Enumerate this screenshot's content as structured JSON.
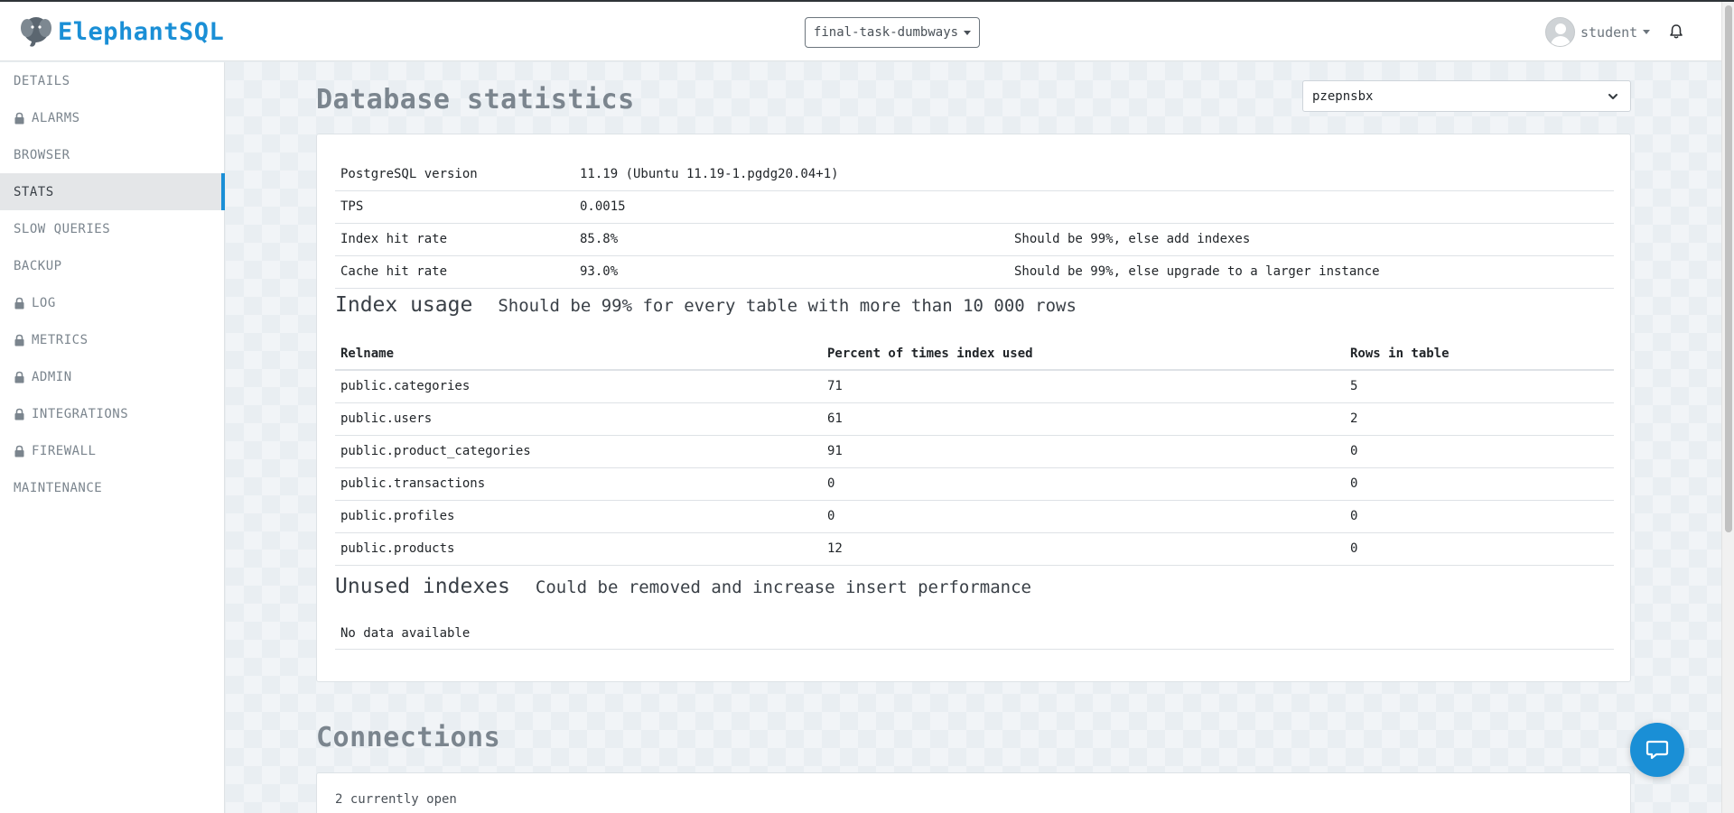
{
  "brand": {
    "name": "ElephantSQL",
    "accent": "#1a8fd6"
  },
  "header": {
    "instance": "final-task-dumbways",
    "user": "student"
  },
  "sidebar": {
    "items": [
      {
        "label": "DETAILS",
        "locked": false,
        "active": false
      },
      {
        "label": "ALARMS",
        "locked": true,
        "active": false
      },
      {
        "label": "BROWSER",
        "locked": false,
        "active": false
      },
      {
        "label": "STATS",
        "locked": false,
        "active": true
      },
      {
        "label": "SLOW QUERIES",
        "locked": false,
        "active": false
      },
      {
        "label": "BACKUP",
        "locked": false,
        "active": false
      },
      {
        "label": "LOG",
        "locked": true,
        "active": false
      },
      {
        "label": "METRICS",
        "locked": true,
        "active": false
      },
      {
        "label": "ADMIN",
        "locked": true,
        "active": false
      },
      {
        "label": "INTEGRATIONS",
        "locked": true,
        "active": false
      },
      {
        "label": "FIREWALL",
        "locked": true,
        "active": false
      },
      {
        "label": "MAINTENANCE",
        "locked": false,
        "active": false
      }
    ]
  },
  "main": {
    "title": "Database statistics",
    "database_select": "pzepnsbx",
    "stats": [
      {
        "label": "PostgreSQL version",
        "value": "11.19 (Ubuntu 11.19-1.pgdg20.04+1)",
        "note": ""
      },
      {
        "label": "TPS",
        "value": "0.0015",
        "note": ""
      },
      {
        "label": "Index hit rate",
        "value": "85.8%",
        "note": "Should be 99%, else add indexes"
      },
      {
        "label": "Cache hit rate",
        "value": "93.0%",
        "note": "Should be 99%, else upgrade to a larger instance"
      }
    ],
    "index_usage": {
      "heading": "Index usage",
      "subheading": "Should be 99% for every table with more than 10 000 rows",
      "columns": [
        "Relname",
        "Percent of times index used",
        "Rows in table"
      ],
      "rows": [
        [
          "public.categories",
          "71",
          "5"
        ],
        [
          "public.users",
          "61",
          "2"
        ],
        [
          "public.product_categories",
          "91",
          "0"
        ],
        [
          "public.transactions",
          "0",
          "0"
        ],
        [
          "public.profiles",
          "0",
          "0"
        ],
        [
          "public.products",
          "12",
          "0"
        ]
      ]
    },
    "unused_indexes": {
      "heading": "Unused indexes",
      "subheading": "Could be removed and increase insert performance",
      "empty_text": "No data available"
    },
    "connections": {
      "title": "Connections",
      "text": "2 currently open"
    }
  }
}
